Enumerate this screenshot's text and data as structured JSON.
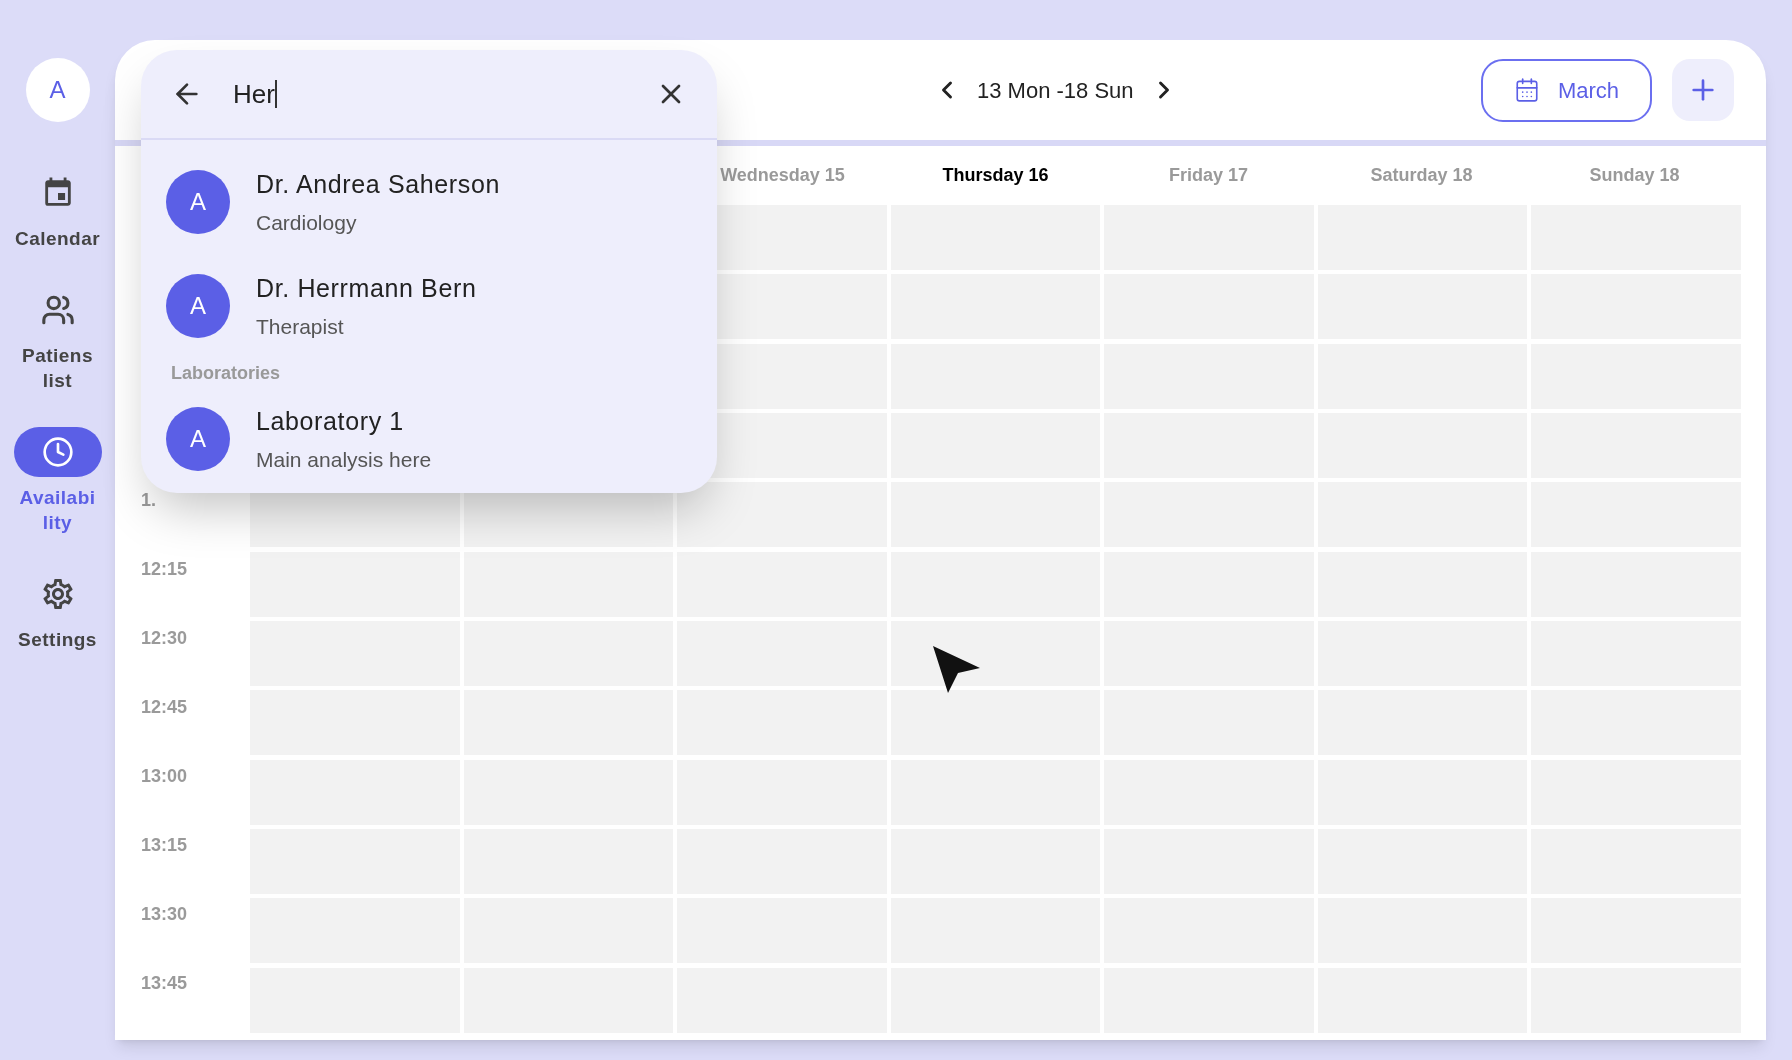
{
  "sidebar": {
    "avatar": "A",
    "items": [
      {
        "kind": "calendar",
        "label": "Calendar",
        "selected": false
      },
      {
        "kind": "patients",
        "label": "Patiens\nlist",
        "selected": false
      },
      {
        "kind": "availability",
        "label": "Availabi\nlity",
        "selected": true
      },
      {
        "kind": "settings",
        "label": "Settings",
        "selected": false
      }
    ]
  },
  "header": {
    "week": "13 Mon -18 Sun",
    "month_button": "March"
  },
  "days": [
    {
      "label": "Wednesday 15",
      "selected": false
    },
    {
      "label": "Thursday 16",
      "selected": true
    },
    {
      "label": "Friday 17",
      "selected": false
    },
    {
      "label": "Saturday 18",
      "selected": false
    },
    {
      "label": "Sunday 18",
      "selected": false
    }
  ],
  "time_labels": [
    "1.",
    "12:15",
    "12:30",
    "12:45",
    "13:00",
    "13:15",
    "13:30",
    "13:45"
  ],
  "search": {
    "value": "Her",
    "results": [
      {
        "kind": "person",
        "avatar": "A",
        "name": "Dr. Andrea Saherson",
        "subtitle": "Cardiology"
      },
      {
        "kind": "person",
        "avatar": "A",
        "name": "Dr. Herrmann Bern",
        "subtitle": "Therapist"
      },
      {
        "kind": "section",
        "label": "Laboratories"
      },
      {
        "kind": "person",
        "avatar": "A",
        "name": "Laboratory 1",
        "subtitle": "Main analysis here"
      }
    ]
  }
}
